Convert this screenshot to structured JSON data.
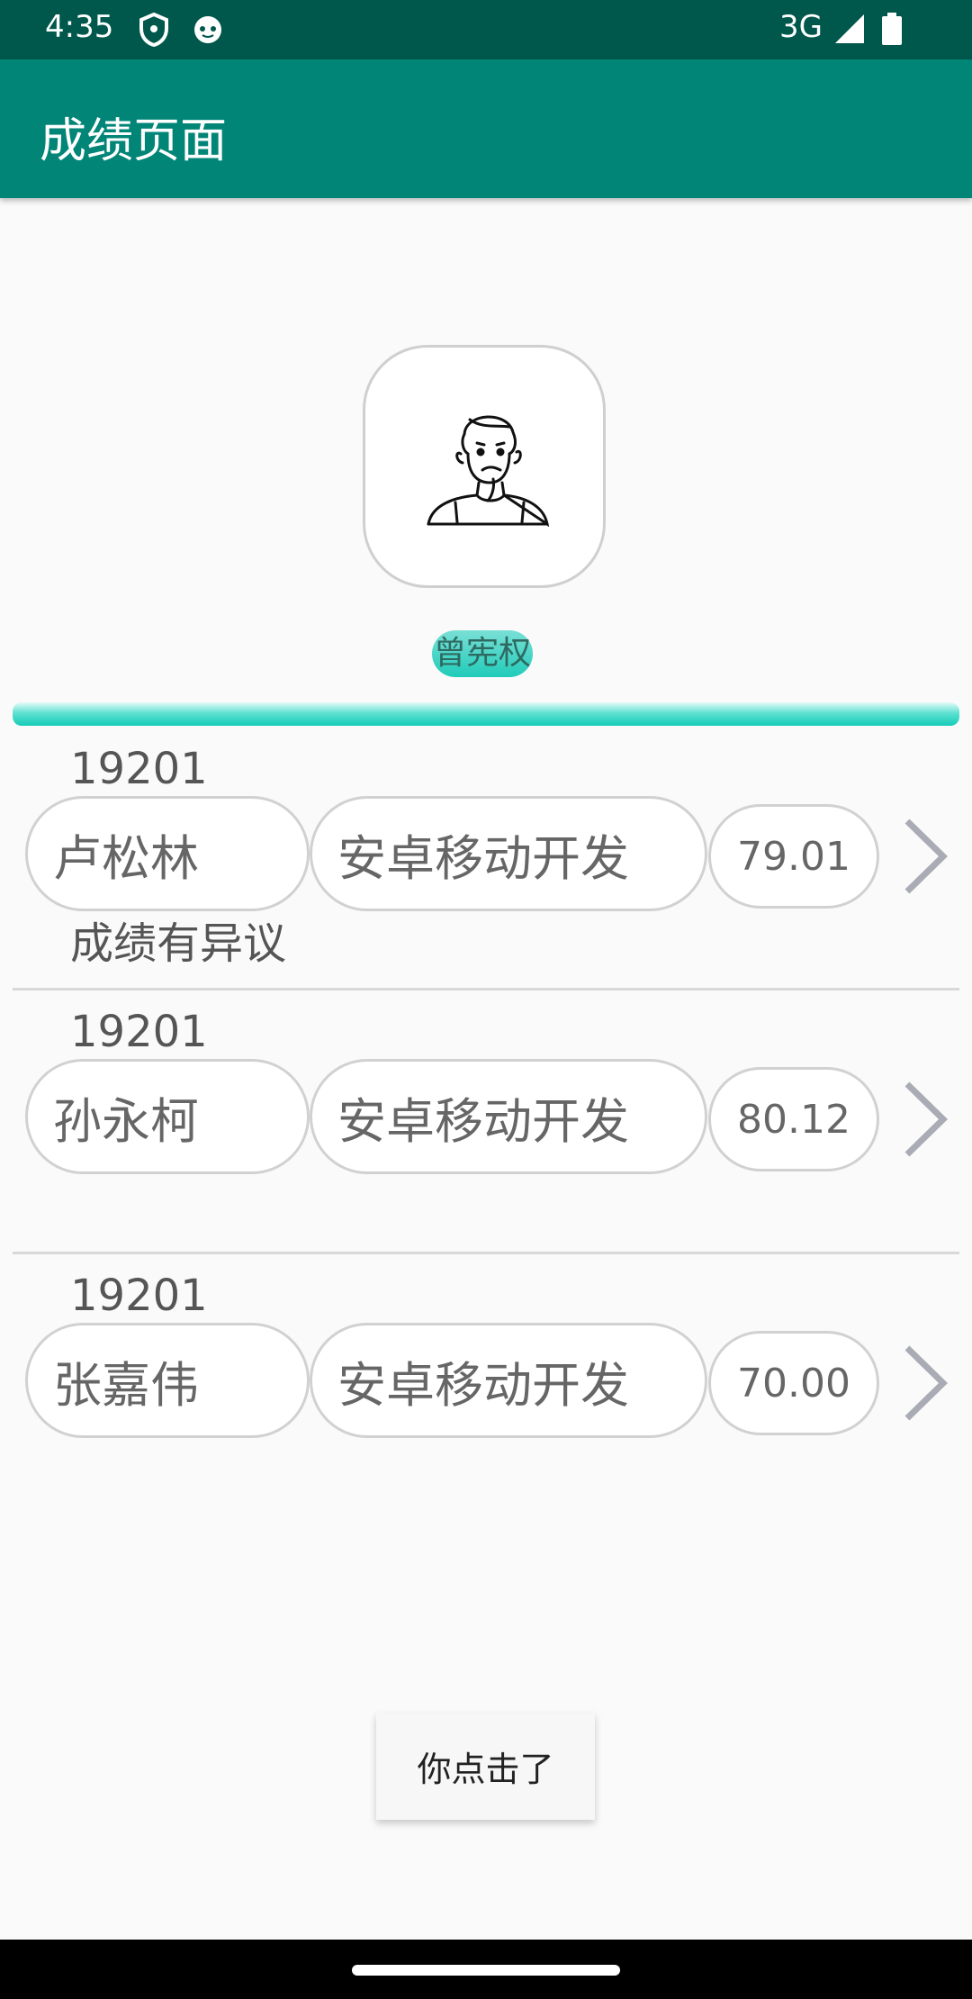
{
  "status_bar": {
    "time": "4:35",
    "network": "3G"
  },
  "app_bar": {
    "title": "成绩页面"
  },
  "profile": {
    "name": "曾宪权"
  },
  "records": [
    {
      "code": "19201",
      "student": "卢松林",
      "course": "安卓移动开发",
      "score": "79.01",
      "remark": "成绩有异议"
    },
    {
      "code": "19201",
      "student": "孙永柯",
      "course": "安卓移动开发",
      "score": "80.12",
      "remark": ""
    },
    {
      "code": "19201",
      "student": "张嘉伟",
      "course": "安卓移动开发",
      "score": "70.00",
      "remark": ""
    }
  ],
  "toast": {
    "text": "你点击了"
  },
  "colors": {
    "status_bar": "#00574b",
    "app_bar": "#008577",
    "accent": "#16cbb9"
  }
}
